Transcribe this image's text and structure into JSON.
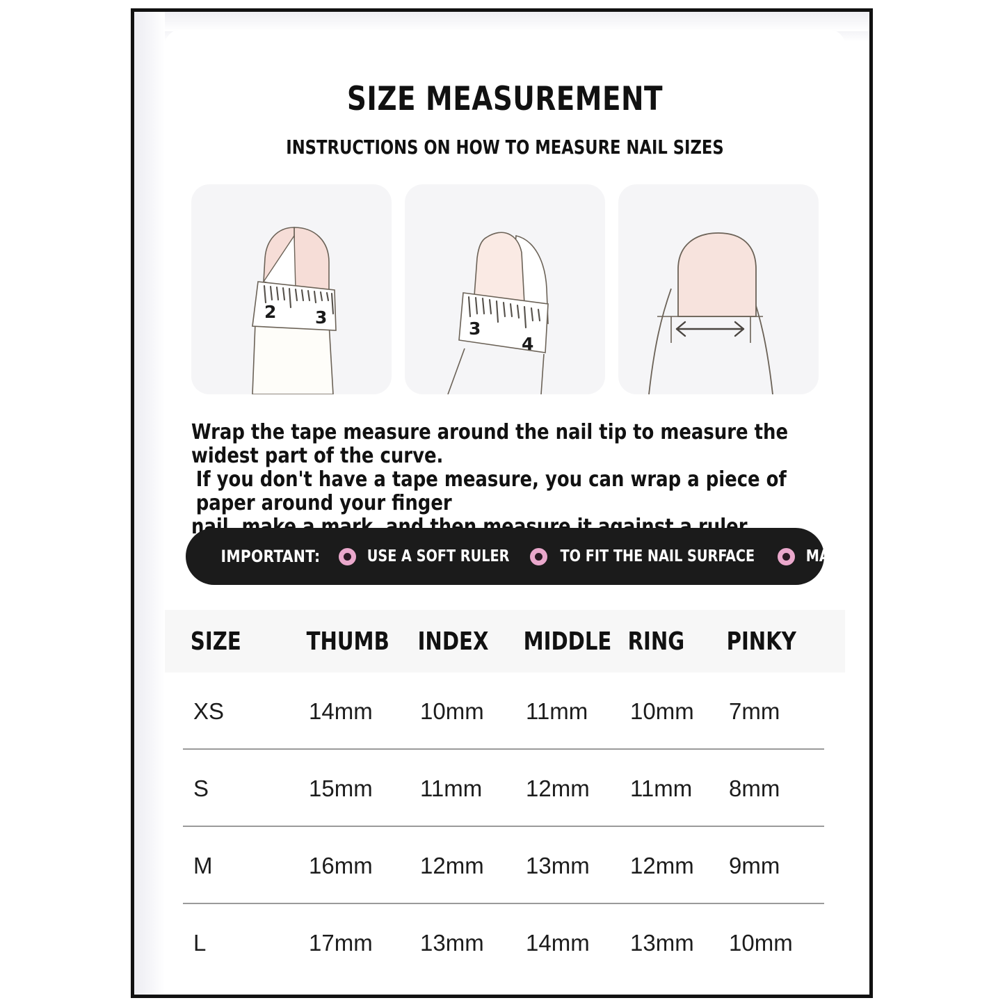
{
  "header": {
    "title": "SIZE MEASUREMENT",
    "subtitle": "INSTRUCTIONS ON HOW TO MEASURE NAIL SIZES"
  },
  "figures": [
    {
      "name": "finger-with-tape-measure-2-3",
      "tick_labels": [
        "2",
        "3"
      ]
    },
    {
      "name": "finger-with-tape-measure-3-4",
      "tick_labels": [
        "3",
        "4"
      ]
    },
    {
      "name": "nail-width-arrow-diagram",
      "tick_labels": []
    }
  ],
  "instructions": {
    "line1": "Wrap the tape measure around the nail tip to measure the widest part of the curve.",
    "line2": "If you don't have a tape measure, you can wrap a piece of paper around your finger",
    "line3": "nail, make a mark, and then measure it against a ruler."
  },
  "banner": {
    "label": "IMPORTANT:",
    "background": "#1b1b1b",
    "bullet_color": "#eaa8cc",
    "items": [
      "USE A SOFT RULER",
      "TO FIT THE NAIL SURFACE",
      "MARK ACCURATELY"
    ]
  },
  "table": {
    "headers": [
      "SIZE",
      "THUMB",
      "INDEX",
      "MIDDLE",
      "RING",
      "PINKY"
    ],
    "rows": [
      {
        "size": "XS",
        "thumb": "14mm",
        "index": "10mm",
        "middle": "11mm",
        "ring": "10mm",
        "pinky": "7mm"
      },
      {
        "size": "S",
        "thumb": "15mm",
        "index": "11mm",
        "middle": "12mm",
        "ring": "11mm",
        "pinky": "8mm"
      },
      {
        "size": "M",
        "thumb": "16mm",
        "index": "12mm",
        "middle": "13mm",
        "ring": "12mm",
        "pinky": "9mm"
      },
      {
        "size": "L",
        "thumb": "17mm",
        "index": "13mm",
        "middle": "14mm",
        "ring": "13mm",
        "pinky": "10mm"
      }
    ]
  }
}
